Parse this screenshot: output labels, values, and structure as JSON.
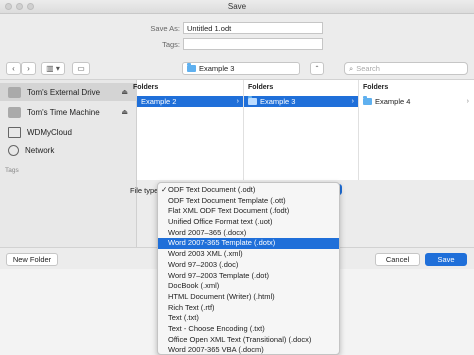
{
  "window": {
    "title": "Save"
  },
  "form": {
    "save_as_label": "Save As:",
    "save_as_value": "Untitled 1.odt",
    "tags_label": "Tags:",
    "tags_value": ""
  },
  "toolbar": {
    "back": "‹",
    "forward": "›",
    "view_mode": "▥ ▾",
    "new_folder_icon": "▭",
    "location": "Example 3",
    "search_placeholder": "Search"
  },
  "sidebar": {
    "items": [
      {
        "label": "Tom's External Drive",
        "icon": "drive-icon",
        "eject": "⏏",
        "selected": true
      },
      {
        "label": "Tom's Time Machine",
        "icon": "drive-icon",
        "eject": "⏏",
        "selected": false
      },
      {
        "label": "WDMyCloud",
        "icon": "monitor-icon",
        "selected": false
      },
      {
        "label": "Network",
        "icon": "globe-icon",
        "selected": false
      }
    ],
    "tags_label": "Tags"
  },
  "browser": {
    "columns": [
      {
        "header": "Folders",
        "item": "Example 2",
        "selected": true
      },
      {
        "header": "Folders",
        "item": "Example 3",
        "selected": true
      },
      {
        "header": "Folders",
        "item": "Example 4",
        "selected": false
      }
    ]
  },
  "file_type": {
    "label": "File type",
    "options": [
      "ODF Text Document (.odt)",
      "ODF Text Document Template (.ott)",
      "Flat XML ODF Text Document (.fodt)",
      "Unified Office Format text (.uot)",
      "Word 2007–365 (.docx)",
      "Word 2007-365 Template (.dotx)",
      "Word 2003 XML (.xml)",
      "Word 97–2003 (.doc)",
      "Word 97–2003 Template (.dot)",
      "DocBook (.xml)",
      "HTML Document (Writer) (.html)",
      "Rich Text (.rtf)",
      "Text (.txt)",
      "Text - Choose Encoding (.txt)",
      "Office Open XML Text (Transitional) (.docx)",
      "Word 2007-365 VBA (.docm)"
    ],
    "checked_index": 0,
    "highlighted_index": 5,
    "check_mark": "✓"
  },
  "footer": {
    "new_folder": "New Folder",
    "cancel": "Cancel",
    "save": "Save"
  },
  "colors": {
    "accent": "#1f6fd9",
    "folder": "#5fb0ef"
  }
}
